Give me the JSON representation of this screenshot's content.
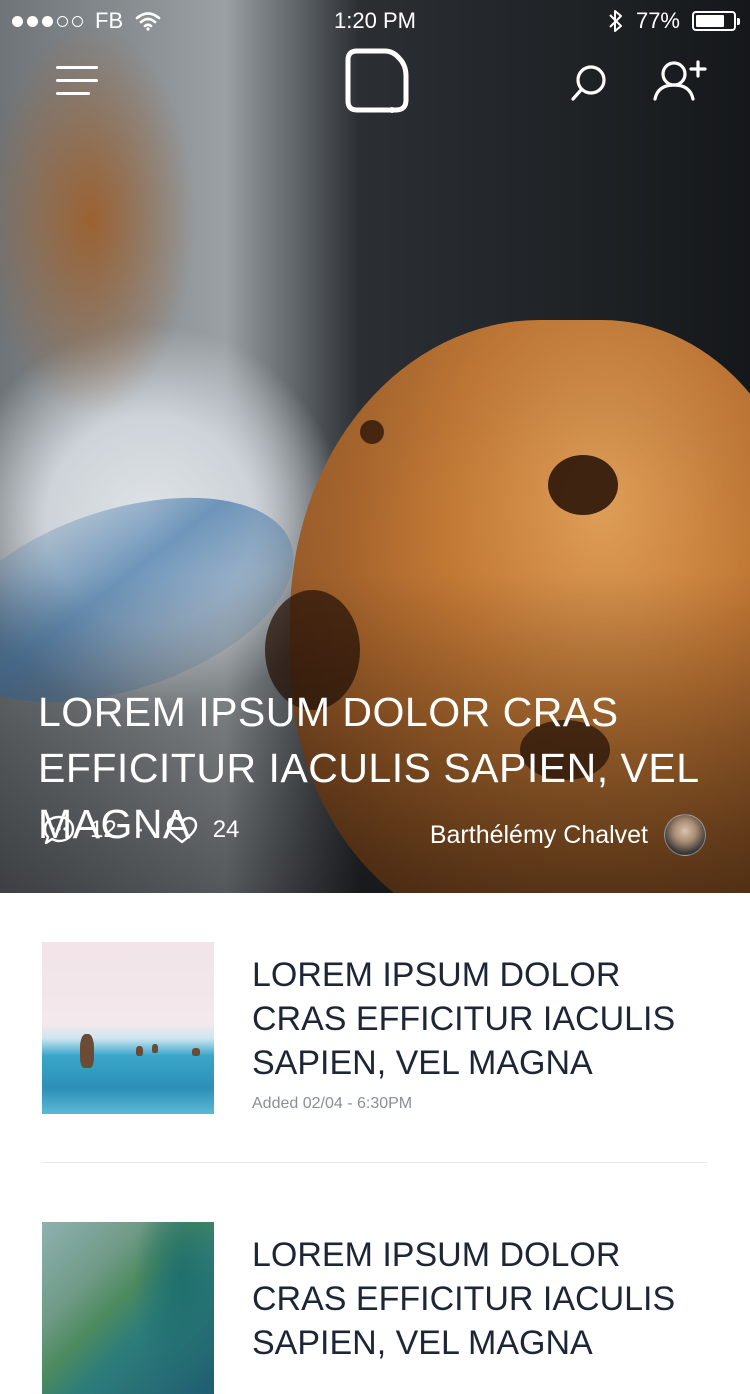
{
  "status_bar": {
    "carrier": "FB",
    "time": "1:20 PM",
    "battery_text": "77%",
    "battery_level": 0.77,
    "signal_dots_filled": 3,
    "signal_dots_total": 5
  },
  "nav": {
    "menu_icon": "hamburger-menu-icon",
    "logo_icon": "app-logo-icon",
    "search_icon": "search-icon",
    "add_user_icon": "add-user-icon"
  },
  "hero": {
    "title": "LOREM IPSUM DOLOR CRAS EFFICITUR IACULIS SAPIEN, VEL MAGNA",
    "comments_count": "12",
    "likes_count": "24",
    "separator": "·",
    "author": "Barthélémy Chalvet"
  },
  "articles": [
    {
      "title": "LOREM IPSUM DOLOR CRAS EFFICITUR IACULIS SAPIEN, VEL MAGNA",
      "date": "Added 02/04 - 6:30PM"
    },
    {
      "title": "LOREM IPSUM DOLOR CRAS EFFICITUR IACULIS SAPIEN, VEL MAGNA",
      "date": ""
    }
  ],
  "colors": {
    "title_text": "#1c2636",
    "date_text": "#8a8f96",
    "divider": "#e7e9ec",
    "white": "#ffffff"
  }
}
